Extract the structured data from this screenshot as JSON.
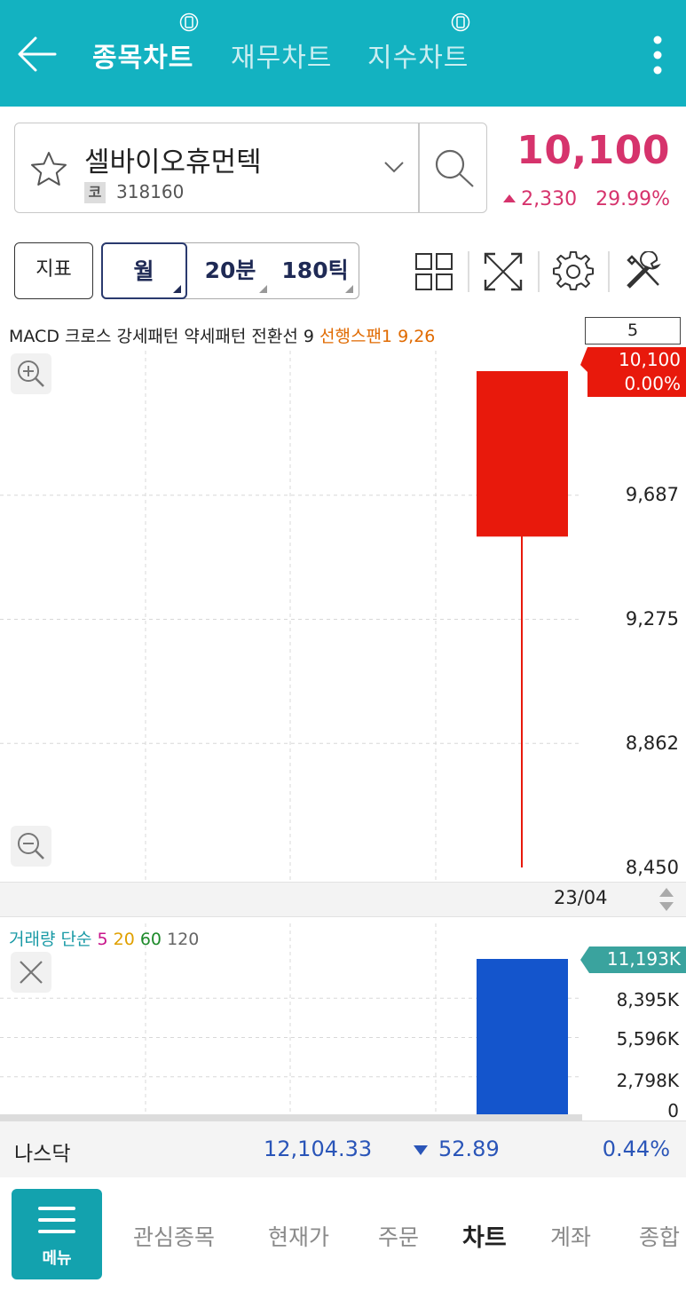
{
  "header": {
    "tabs": [
      {
        "label": "종목차트",
        "active": true
      },
      {
        "label": "재무차트",
        "active": false
      },
      {
        "label": "지수차트",
        "active": false
      }
    ]
  },
  "stock": {
    "name": "셀바이오휴먼텍",
    "code_tag": "코",
    "code": "318160",
    "price": "10,100",
    "change": "2,330",
    "change_pct": "29.99%"
  },
  "toolbar": {
    "indicator_label": "지표",
    "periods": [
      "월",
      "20분",
      "180틱"
    ]
  },
  "chart": {
    "legend": {
      "main": "MACD 크로스 강세패턴 약세패턴 전환선 9 ",
      "highlight": "선행스팬1 9,26"
    },
    "count": "5",
    "current_tag": {
      "price": "10,100",
      "pct": "0.00%"
    },
    "y_ticks": [
      "9,687",
      "9,275",
      "8,862",
      "8,450"
    ],
    "x_label": "23/04",
    "colors": {
      "up": "#e8190c",
      "volume": "#1455cc",
      "tag_volume": "#3aa39e"
    }
  },
  "chart_data": {
    "type": "candlestick",
    "x": [
      "23/04"
    ],
    "ohlc": [
      {
        "open": 9550,
        "high": 10100,
        "low": 8450,
        "close": 10100
      }
    ],
    "ylim": [
      8450,
      10100
    ],
    "volume": {
      "values": [
        11193
      ],
      "unit": "K",
      "ylim": [
        0,
        11193
      ]
    }
  },
  "volume": {
    "legend": [
      {
        "text": "거래량 ",
        "color": "#1a9aa6"
      },
      {
        "text": "단순 ",
        "color": "#1a9aa6"
      },
      {
        "text": "5 ",
        "color": "#c8148a"
      },
      {
        "text": "20 ",
        "color": "#e0a000"
      },
      {
        "text": "60 ",
        "color": "#1d8a2a"
      },
      {
        "text": "120",
        "color": "#666666"
      }
    ],
    "current_tag": "11,193K",
    "ticks": [
      "8,395K",
      "5,596K",
      "2,798K",
      "0"
    ]
  },
  "ticker": {
    "name": "나스닥",
    "value": "12,104.33",
    "change": "52.89",
    "pct": "0.44%"
  },
  "bottom_nav": {
    "menu_label": "메뉴",
    "items": [
      "관심종목",
      "현재가",
      "주문",
      "차트",
      "계좌",
      "종합"
    ],
    "active": "차트"
  }
}
